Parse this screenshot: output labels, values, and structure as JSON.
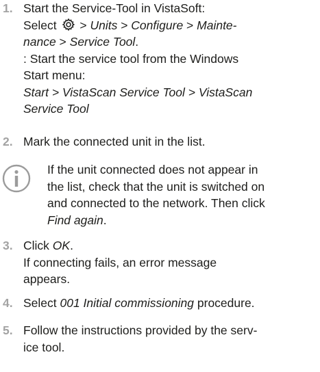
{
  "steps": [
    {
      "number": "1.",
      "line1": "Start the Service-Tool in VistaSoft:",
      "line2_prefix": "Select",
      "line2_sep1": " > ",
      "line2_units": "Units",
      "line2_sep2": " > ",
      "line2_configure": "Configure",
      "line2_sep3": " > ",
      "line2_mainte": "Mainte-",
      "line3_nance": "nance",
      "line3_sep": " > ",
      "line3_servicetool": "Service Tool",
      "line3_end": ".",
      "line4": ": Start the service tool from the Windows",
      "line5": "Start menu:",
      "line6": "Start > VistaScan Service Tool > VistaScan",
      "line7": "Service Tool"
    },
    {
      "number": "2.",
      "text": "Mark the connected unit in the list."
    },
    {
      "number": "3.",
      "click_prefix": "Click ",
      "click_ok": "OK",
      "click_end": ".",
      "line2": "If connecting fails, an error message",
      "line3": "appears."
    },
    {
      "number": "4.",
      "prefix": "Select ",
      "procedure": "001 Initial commissioning",
      "suffix": " procedure."
    },
    {
      "number": "5.",
      "line1": "Follow the instructions provided by the serv-",
      "line2": "ice tool."
    }
  ],
  "note": {
    "line1": "If the unit connected does not appear in",
    "line2": "the list, check that the unit is switched on",
    "line3": "and connected to the network. Then click",
    "line4_link": "Find again",
    "line4_end": "."
  },
  "icons": {
    "settings": "gear-icon",
    "info": "info-icon"
  },
  "colors": {
    "text": "#1d1d1b",
    "numbers": "#a3a3a3",
    "icon": "#9b9b9b"
  }
}
